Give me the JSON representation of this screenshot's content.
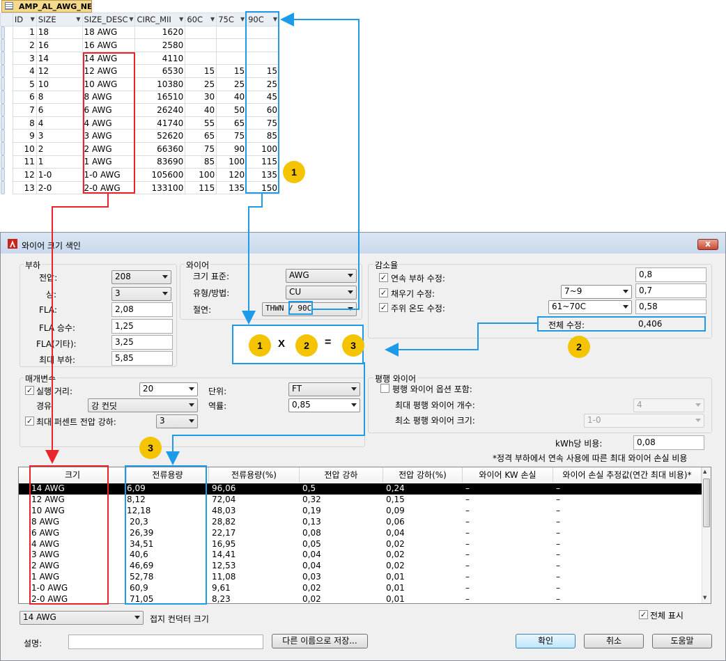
{
  "access": {
    "tab_title": "AMP_AL_AWG_NEC",
    "columns": [
      "ID",
      "SIZE",
      "SIZE_DESC",
      "CIRC_MII",
      "60C",
      "75C",
      "90C"
    ],
    "rows": [
      [
        "1",
        "18",
        "18 AWG",
        "1620",
        "",
        "",
        ""
      ],
      [
        "2",
        "16",
        "16 AWG",
        "2580",
        "",
        "",
        ""
      ],
      [
        "3",
        "14",
        "14 AWG",
        "4110",
        "",
        "",
        ""
      ],
      [
        "4",
        "12",
        "12 AWG",
        "6530",
        "15",
        "15",
        "15"
      ],
      [
        "5",
        "10",
        "10 AWG",
        "10380",
        "25",
        "25",
        "25"
      ],
      [
        "6",
        "8",
        "8 AWG",
        "16510",
        "30",
        "40",
        "45"
      ],
      [
        "7",
        "6",
        "6 AWG",
        "26240",
        "40",
        "50",
        "60"
      ],
      [
        "8",
        "4",
        "4 AWG",
        "41740",
        "55",
        "65",
        "75"
      ],
      [
        "9",
        "3",
        "3 AWG",
        "52620",
        "65",
        "75",
        "85"
      ],
      [
        "10",
        "2",
        "2 AWG",
        "66360",
        "75",
        "90",
        "100"
      ],
      [
        "11",
        "1",
        "1 AWG",
        "83690",
        "85",
        "100",
        "115"
      ],
      [
        "12",
        "1-0",
        "1-0 AWG",
        "105600",
        "100",
        "120",
        "135"
      ],
      [
        "13",
        "2-0",
        "2-0 AWG",
        "133100",
        "115",
        "135",
        "150"
      ]
    ]
  },
  "dialog": {
    "title": "와이어 크기 색인",
    "close_label": "x",
    "load": {
      "group": "부하",
      "voltage_label": "전압:",
      "voltage": "208",
      "phase_label": "상:",
      "phase": "3",
      "fla_label": "FLA:",
      "fla": "2,08",
      "fla_mult_label": "FLA 승수:",
      "fla_mult": "1,25",
      "fla_other_label": "FLA(기타):",
      "fla_other": "3,25",
      "max_load_label": "최대 부하:",
      "max_load": "5,85"
    },
    "wire": {
      "group": "와이어",
      "size_std_label": "크기 표준:",
      "size_std": "AWG",
      "type_label": "유형/방법:",
      "type": "CU",
      "insul_label": "절연:",
      "insul_a": "THWN",
      "insul_b": "90C"
    },
    "derate": {
      "group": "감소율",
      "cont_label": "연속 부하 수정:",
      "cont": "0,8",
      "fill_label": "채우기 수정:",
      "fill_sel": "7~9",
      "fill": "0,7",
      "amb_label": "주위 온도 수정:",
      "amb_sel": "61~70C",
      "amb": "0,58",
      "total_label": "전체 수정:",
      "total": "0,406"
    },
    "params": {
      "group": "매개변수",
      "run_label": "실행 거리:",
      "run": "20",
      "unit_label": "단위:",
      "unit": "FT",
      "route_label": "경유",
      "route": "강 컨딧",
      "pf_label": "역률:",
      "pf": "0,85",
      "vdrop_label": "최대 퍼센트 전압 강하:",
      "vdrop": "3"
    },
    "parallel": {
      "group": "평행 와이어",
      "include_label": "평행 와이어 옵션 포함:",
      "max_count_label": "최대 평행 와이어 개수:",
      "max_count": "4",
      "min_size_label": "최소 평행 와이어 크기:",
      "min_size": "1-0"
    },
    "kwh_label": "kWh당 비용:",
    "kwh": "0,08",
    "note": "*정격 부하에서 연속 사용에 따른 최대 와이어 손실 비용",
    "table": {
      "headers": [
        "크기",
        "전류용량",
        "전류용량(%)",
        "전압 강하",
        "전압 강하(%)",
        "와이어 KW 손실",
        "와이어 손실 추정값(연간 최대 비용)*"
      ],
      "rows": [
        [
          "14 AWG",
          "6,09",
          "96,06",
          "0,5",
          "0,24",
          "–",
          "–"
        ],
        [
          "12 AWG",
          "8,12",
          "72,04",
          "0,32",
          "0,15",
          "–",
          "–"
        ],
        [
          "10 AWG",
          "12,18",
          "48,03",
          "0,19",
          "0,09",
          "–",
          "–"
        ],
        [
          "8 AWG",
          "20,3",
          "28,82",
          "0,13",
          "0,06",
          "–",
          "–"
        ],
        [
          "6 AWG",
          "26,39",
          "22,17",
          "0,08",
          "0,04",
          "–",
          "–"
        ],
        [
          "4 AWG",
          "34,51",
          "16,95",
          "0,05",
          "0,02",
          "–",
          "–"
        ],
        [
          "3 AWG",
          "40,6",
          "14,41",
          "0,04",
          "0,02",
          "–",
          "–"
        ],
        [
          "2 AWG",
          "46,69",
          "12,53",
          "0,04",
          "0,02",
          "–",
          "–"
        ],
        [
          "1 AWG",
          "52,78",
          "11,08",
          "0,03",
          "0,01",
          "–",
          "–"
        ],
        [
          "1-0 AWG",
          "60,9",
          "9,61",
          "0,02",
          "0,01",
          "–",
          "–"
        ],
        [
          "2-0 AWG",
          "71,05",
          "8,23",
          "0,02",
          "0,01",
          "–",
          "–"
        ]
      ]
    },
    "ground_sel": "14 AWG",
    "ground_label": "접지 컨덕터 크기",
    "show_all_label": "전체 표시",
    "desc_label": "설명:",
    "save_as": "다른 이름으로 저장...",
    "ok": "확인",
    "cancel": "취소",
    "help": "도움말"
  },
  "annotation": {
    "b1": "1",
    "b2": "2",
    "b3": "3",
    "x": "X",
    "eq": "="
  },
  "colors": {
    "red_box": "#e8242a",
    "blue_box": "#1e9be8",
    "badge": "#f5c400"
  }
}
